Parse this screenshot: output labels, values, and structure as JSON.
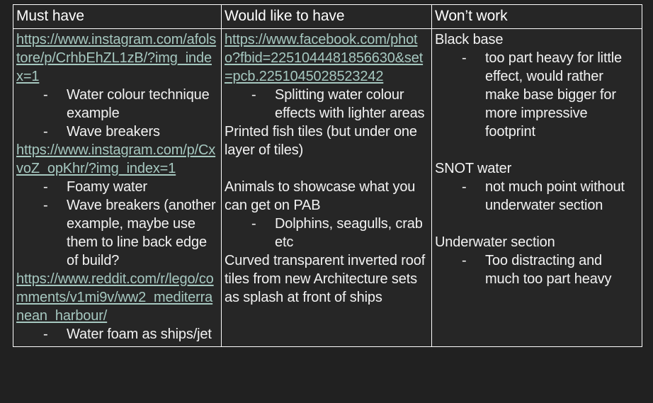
{
  "page": {
    "background_color": "#212121",
    "cell_background_color": "#262626",
    "border_color": "#fdfdfd",
    "text_color": "#f2f2f2",
    "link_color": "#a6c8c0",
    "bullet_glyph": "-"
  },
  "table": {
    "headers": [
      "Must have",
      "Would like to have",
      "Won’t work"
    ],
    "columns": [
      {
        "name": "must-have",
        "blocks": [
          {
            "type": "link",
            "text": "https://www.instagram.com/afolstore/p/CrhbEhZL1zB/?img_index=1"
          },
          {
            "type": "bullets",
            "items": [
              "Water colour technique example",
              "Wave breakers"
            ]
          },
          {
            "type": "link",
            "text": "https://www.instagram.com/p/CxvoZ_opKhr/?img_index=1"
          },
          {
            "type": "bullets",
            "items": [
              "Foamy water",
              "Wave breakers (another example, maybe use them to line back edge of build?"
            ]
          },
          {
            "type": "link",
            "text": "https://www.reddit.com/r/lego/comments/v1mi9v/ww2_mediterranean_harbour/"
          },
          {
            "type": "bullets",
            "items": [
              "Water foam as ships/jet"
            ]
          }
        ]
      },
      {
        "name": "would-like-to-have",
        "blocks": [
          {
            "type": "link",
            "text": "https://www.facebook.com/photo?fbid=2251044481856630&set=pcb.2251045028523242"
          },
          {
            "type": "bullets",
            "items": [
              "Splitting water colour effects with lighter areas"
            ]
          },
          {
            "type": "para",
            "text": "Printed fish tiles (but under one layer of tiles)"
          },
          {
            "type": "spacer"
          },
          {
            "type": "para",
            "text": "Animals to showcase what you can get on PAB"
          },
          {
            "type": "bullets",
            "items": [
              "Dolphins, seagulls, crab etc"
            ]
          },
          {
            "type": "para",
            "text": "Curved transparent inverted roof tiles from new Architecture sets as splash at front of ships"
          }
        ]
      },
      {
        "name": "wont-work",
        "blocks": [
          {
            "type": "para",
            "text": "Black base"
          },
          {
            "type": "bullets",
            "items": [
              "too part heavy for little effect, would rather make base bigger for more impressive footprint"
            ]
          },
          {
            "type": "spacer"
          },
          {
            "type": "para",
            "text": "SNOT water"
          },
          {
            "type": "bullets",
            "items": [
              "not much point without underwater section"
            ]
          },
          {
            "type": "spacer"
          },
          {
            "type": "para",
            "text": "Underwater section"
          },
          {
            "type": "bullets",
            "items": [
              "Too distracting and much too part heavy"
            ]
          }
        ]
      }
    ]
  }
}
